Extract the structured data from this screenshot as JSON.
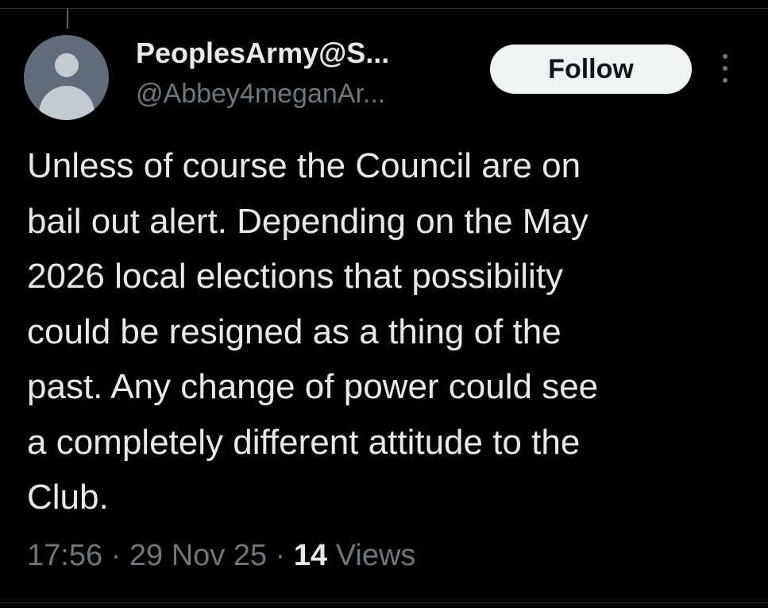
{
  "post": {
    "author": {
      "display_name": "PeoplesArmy@S...",
      "handle": "@Abbey4meganAr...",
      "avatar_icon": "default-user-avatar-icon"
    },
    "actions": {
      "follow_label": "Follow",
      "more_icon": "vertical-ellipsis-icon"
    },
    "text_lines": [
      "Unless of course the Council are on",
      "bail out alert. Depending on the May",
      "2026 local elections that possibility",
      "could be resigned as a thing of the",
      "past. Any change of power could see",
      "a completely different attitude to the",
      "Club."
    ],
    "meta": {
      "time": "17:56",
      "separator": " · ",
      "date": "29 Nov 25",
      "views_count": "14",
      "views_label": " Views"
    }
  },
  "colors": {
    "background": "#000000",
    "primary_text": "#e7e9ea",
    "secondary_text": "#71767b",
    "follow_button_bg": "#eff3f4",
    "follow_button_text": "#0f1419",
    "avatar_bg": "#606c77",
    "avatar_figure": "#c3cbd1"
  }
}
